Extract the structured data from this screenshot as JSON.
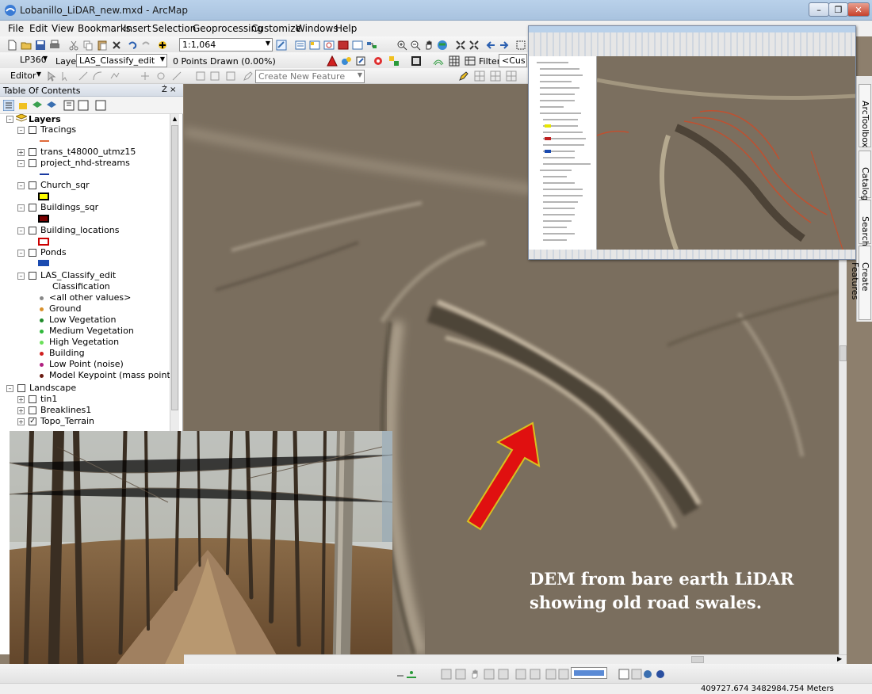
{
  "window": {
    "title": "Lobanillo_LiDAR_new.mxd - ArcMap"
  },
  "menu": [
    "File",
    "Edit",
    "View",
    "Bookmarks",
    "Insert",
    "Selection",
    "Geoprocessing",
    "Customize",
    "Windows",
    "Help"
  ],
  "toolbar1": {
    "scale": "1:1,064"
  },
  "toolbar2": {
    "lp360_label": "LP360",
    "layer_label": "Layer:",
    "layer_value": "LAS_Classify_edit",
    "points_drawn": "0 Points Drawn (0.00%)",
    "filter_label": "Filter:",
    "filter_value": "<Cus"
  },
  "toolbar3": {
    "editor_label": "Editor",
    "create_feature": "Create New Feature"
  },
  "toc": {
    "title": "Table Of Contents",
    "pin": "Ź ×",
    "root": "Layers",
    "layers": [
      {
        "name": "Tracings"
      },
      {
        "name": "trans_t48000_utmz15"
      },
      {
        "name": "project_nhd-streams"
      },
      {
        "name": "Church_sqr"
      },
      {
        "name": "Buildings_sqr"
      },
      {
        "name": "Building_locations"
      },
      {
        "name": "Ponds"
      },
      {
        "name": "LAS_Classify_edit"
      }
    ],
    "classification_header": "Classification",
    "classes": [
      {
        "label": "<all other values>",
        "color": "#888888"
      },
      {
        "label": "Ground",
        "color": "#d8902a"
      },
      {
        "label": "Low Vegetation",
        "color": "#1f8a2a"
      },
      {
        "label": "Medium Vegetation",
        "color": "#2fb83a"
      },
      {
        "label": "High Vegetation",
        "color": "#6be05a"
      },
      {
        "label": "Building",
        "color": "#d02020"
      },
      {
        "label": "Low Point (noise)",
        "color": "#b02080"
      },
      {
        "label": "Model Keypoint (mass point)",
        "color": "#6a1a10"
      }
    ],
    "landscape": "Landscape",
    "landscape_items": [
      "tin1",
      "Breaklines1",
      "Topo_Terrain"
    ]
  },
  "right_dock": [
    "ArcToolbox",
    "Catalog",
    "Search",
    "Create Features"
  ],
  "map": {
    "caption_line1": "DEM from bare earth LiDAR",
    "caption_line2": "showing old road swales."
  },
  "status": {
    "coordinates": "409727.674  3482984.754 Meters"
  },
  "colors": {
    "arrow": "#e01010",
    "arrow_outline": "#d8c020",
    "caption": "#ffffff"
  }
}
